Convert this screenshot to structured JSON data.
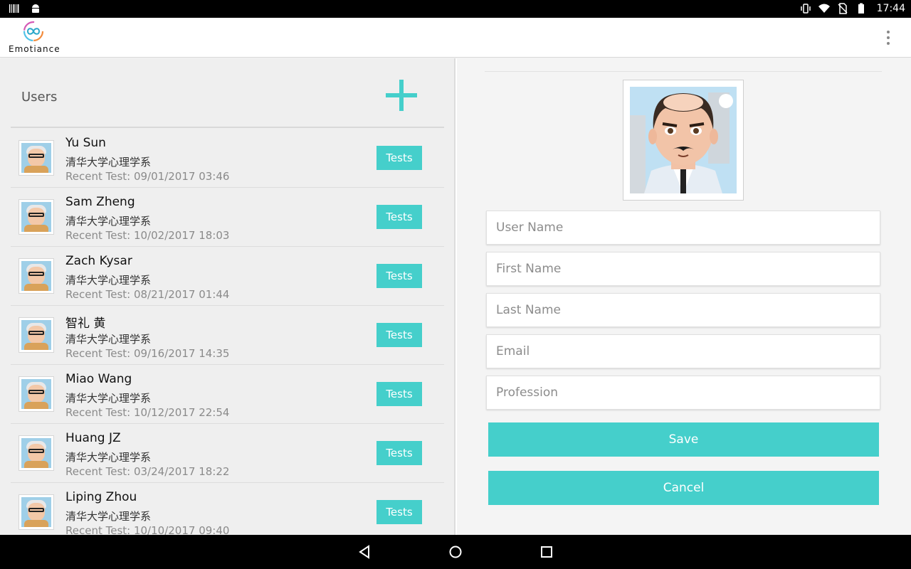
{
  "status_bar": {
    "time": "17:44",
    "left_icons": [
      "barcode-icon",
      "android-icon"
    ],
    "right_icons": [
      "vibrate-icon",
      "wifi-icon",
      "no-sim-icon",
      "battery-icon"
    ]
  },
  "app_bar": {
    "logo_text": "Emotiance",
    "overflow_icon": "more-vert-icon"
  },
  "users_panel": {
    "title": "Users",
    "add_icon": "plus-icon",
    "tests_label": "Tests",
    "users": [
      {
        "name": "Yu Sun",
        "department": "清华大学心理学系",
        "recent_test": "Recent Test: 09/01/2017 03:46"
      },
      {
        "name": "Sam Zheng",
        "department": "清华大学心理学系",
        "recent_test": "Recent Test: 10/02/2017 18:03"
      },
      {
        "name": "Zach Kysar",
        "department": "清华大学心理学系",
        "recent_test": "Recent Test: 08/21/2017 01:44"
      },
      {
        "name": "智礼 黄",
        "department": "清华大学心理学系",
        "recent_test": "Recent Test: 09/16/2017 14:35"
      },
      {
        "name": "Miao Wang",
        "department": "清华大学心理学系",
        "recent_test": "Recent Test: 10/12/2017 22:54"
      },
      {
        "name": "Huang JZ",
        "department": "清华大学心理学系",
        "recent_test": "Recent Test: 03/24/2017 18:22"
      },
      {
        "name": "Liping Zhou",
        "department": "清华大学心理学系",
        "recent_test": "Recent Test: 10/10/2017 09:40"
      }
    ]
  },
  "form": {
    "fields": {
      "username": {
        "placeholder": "User Name",
        "value": ""
      },
      "first_name": {
        "placeholder": "First Name",
        "value": ""
      },
      "last_name": {
        "placeholder": "Last Name",
        "value": ""
      },
      "email": {
        "placeholder": "Email",
        "value": ""
      },
      "profession": {
        "placeholder": "Profession",
        "value": ""
      }
    },
    "save_label": "Save",
    "cancel_label": "Cancel"
  },
  "colors": {
    "accent": "#45cfcb",
    "status_bar": "#000000",
    "panel_bg": "#efefef"
  },
  "nav_bar": {
    "icons": [
      "back-icon",
      "home-icon",
      "recents-icon"
    ]
  }
}
